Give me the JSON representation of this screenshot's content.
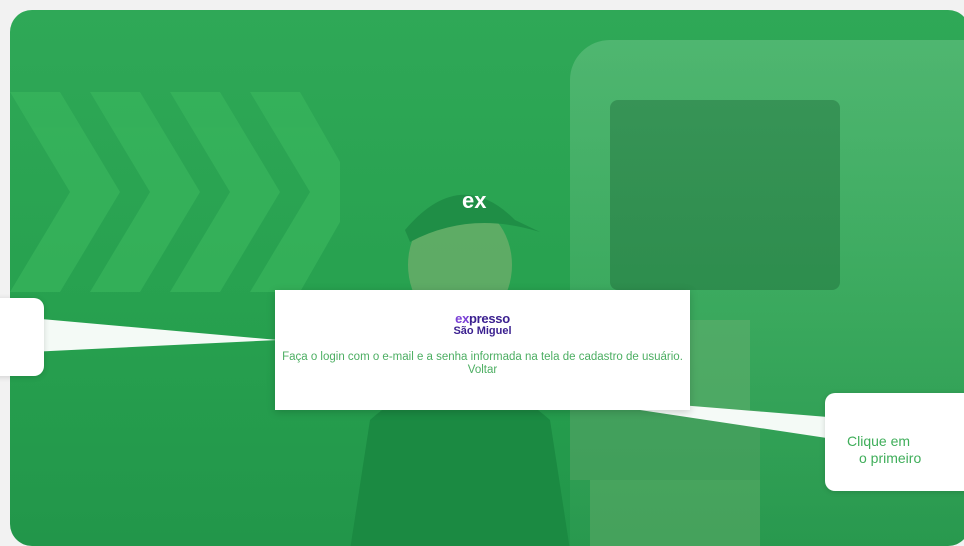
{
  "login_card": {
    "logo_top_prefix": "ex",
    "logo_top_rest": "presso",
    "logo_bottom": "São Miguel",
    "message": "Faça o login com o e-mail e a senha informada na tela de cadastro de usuário.",
    "back_link": "Voltar"
  },
  "callout_right": {
    "line1": "Clique em",
    "line2": "o primeiro"
  },
  "cap": {
    "logo": "ex"
  },
  "colors": {
    "brand_green": "#27a14f",
    "brand_purple": "#3a1f8f",
    "text_green": "#4cae62"
  }
}
